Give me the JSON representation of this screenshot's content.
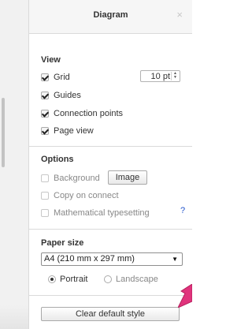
{
  "panel": {
    "title": "Diagram",
    "close_glyph": "×"
  },
  "view": {
    "title": "View",
    "items": [
      {
        "label": "Grid",
        "checked": true
      },
      {
        "label": "Guides",
        "checked": true
      },
      {
        "label": "Connection points",
        "checked": true
      },
      {
        "label": "Page view",
        "checked": true
      }
    ],
    "grid_size": "10 pt"
  },
  "options": {
    "title": "Options",
    "background_label": "Background",
    "image_button": "Image",
    "copy_on_connect_label": "Copy on connect",
    "math_label": "Mathematical typesetting",
    "help_glyph": "?"
  },
  "paper": {
    "title": "Paper size",
    "selected": "A4 (210 mm x 297 mm)",
    "portrait_label": "Portrait",
    "landscape_label": "Landscape",
    "orientation": "Portrait"
  },
  "footer": {
    "clear_button": "Clear default style"
  },
  "colors": {
    "accent_link": "#2255cc",
    "pointer_arrow": "#e0337c"
  },
  "icons": [
    "close-icon",
    "checkbox-icon",
    "spinner-arrows-icon",
    "help-icon",
    "dropdown-caret-icon",
    "radio-icon",
    "pointer-arrow-icon"
  ]
}
